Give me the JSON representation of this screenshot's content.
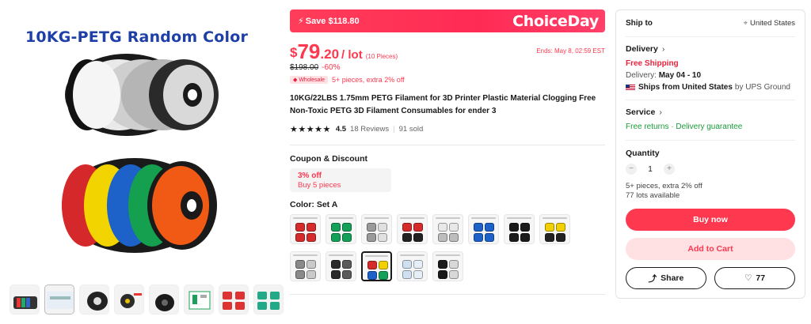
{
  "gallery": {
    "caption": "10KG-PETG Random Color",
    "thumb_count": 9,
    "selected_thumb": 2
  },
  "promo": {
    "save_text": "Save $118.80",
    "brand": "ChoiceDay",
    "bg_color": "#ff2b55"
  },
  "price": {
    "currency": "$",
    "integer": "79",
    "decimal": ".20",
    "unit": "/ lot",
    "pieces_note": "(10 Pieces)",
    "ends": "Ends: May 8, 02:59 EST",
    "original": "$198.00",
    "discount": "-60%",
    "wholesale_tag": "Wholesale",
    "wholesale_note": "5+ pieces, extra 2% off",
    "accent_color": "#fd384f"
  },
  "product": {
    "title": "10KG/22LBS 1.75mm PETG Filament for 3D Printer Plastic Material Clogging Free Non-Toxic PETG 3D Filament Consumables for ender 3",
    "stars": "★★★★★",
    "rating": "4.5",
    "reviews": "18 Reviews",
    "sold": "91 sold"
  },
  "coupon": {
    "heading": "Coupon & Discount",
    "percent": "3% off",
    "condition": "Buy 5 pieces"
  },
  "color": {
    "heading": "Color: Set A",
    "selected_index": 10
  },
  "buy_panel": {
    "ship_to_label": "Ship to",
    "ship_to_value": "United States",
    "delivery_label": "Delivery",
    "free_shipping": "Free Shipping",
    "delivery_prefix": "Delivery:",
    "delivery_dates": "May 04 - 10",
    "ships_from": "Ships from United States",
    "ships_by": "by UPS Ground",
    "service_label": "Service",
    "service_lines": "Free returns · Delivery guarantee",
    "quantity_label": "Quantity",
    "quantity_value": "1",
    "qty_note": "5+ pieces, extra 2% off",
    "available": "77 lots available",
    "buy_now": "Buy now",
    "add_to_cart": "Add to Cart",
    "share": "Share",
    "wish_count": "77"
  }
}
